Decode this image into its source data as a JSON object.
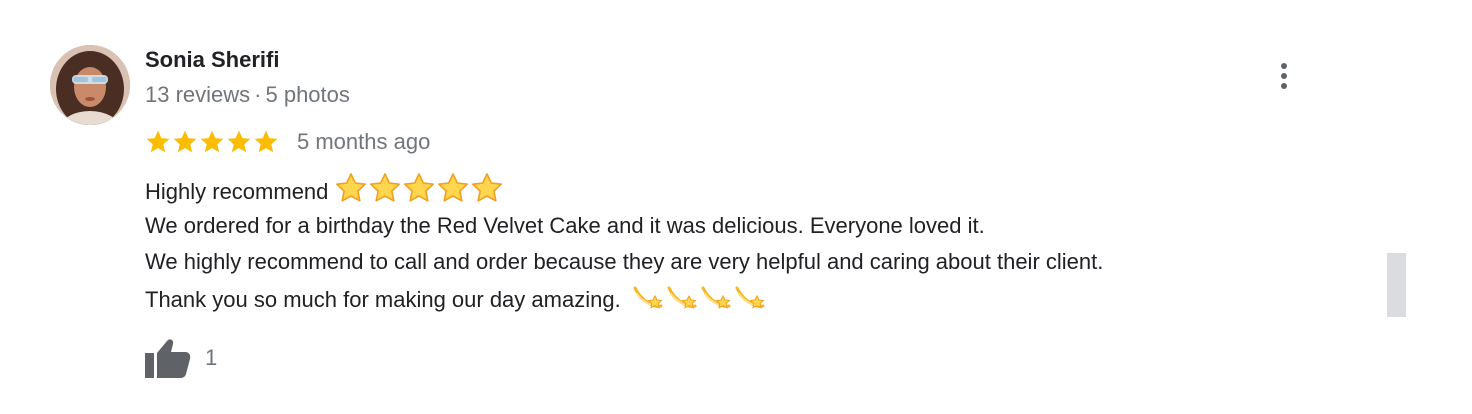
{
  "review": {
    "author": {
      "name": "Sonia Sherifi",
      "reviews": "13 reviews",
      "separator": "·",
      "photos": "5 photos"
    },
    "rating": 5,
    "rating_max": 5,
    "star_color": "#fbbc04",
    "time_ago": "5 months ago",
    "lines": [
      "Highly recommend",
      "We ordered for a birthday the Red Velvet Cake and it was delicious. Everyone loved it.",
      "We highly recommend to call and order because they are very helpful and caring about their client.",
      "Thank you so much for making our day amazing."
    ],
    "like_count": "1",
    "icons": {
      "more": "more-vert-icon",
      "like": "thumbs-up-icon",
      "star_emoji": "star-emoji",
      "dizzy_emoji": "dizzy-emoji"
    },
    "colors": {
      "name": "#202124",
      "secondary": "#70757a",
      "scrollbar": "#dadce0"
    }
  }
}
